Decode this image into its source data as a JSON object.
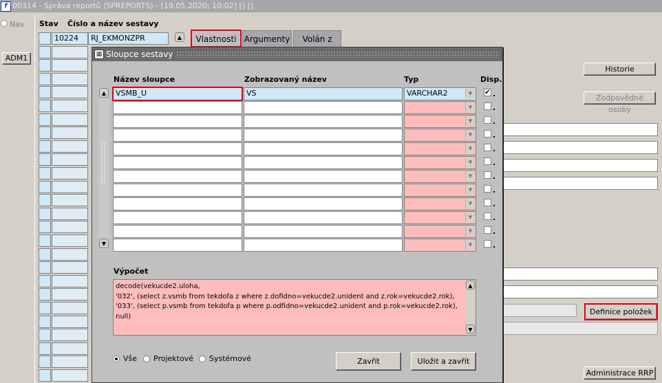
{
  "window": {
    "title": "00314 - Správa reportů (SPREPORTS) - [19.05.2020; 10:02]  []  []",
    "app_icon": "app-logo-icon"
  },
  "left_panel": {
    "nav_label": "Nav",
    "adm_button": "ADM1"
  },
  "main": {
    "col_stav": "Stav",
    "col_cislo": "Číslo a název sestavy",
    "report_number": "10224",
    "report_name": "RJ_EKMONZPR",
    "tabs": [
      {
        "label": "Vlastnosti"
      },
      {
        "label": "Argumenty"
      },
      {
        "label": "Volán z"
      }
    ],
    "buttons": {
      "historie": "Historie",
      "zodpovedne": "Zodpovědné osoby",
      "definice": "Definice položek",
      "administrace": "Administrace RRP"
    }
  },
  "dialog": {
    "title": "Sloupce sestavy",
    "headers": {
      "nazev": "Název sloupce",
      "zobrazovany": "Zobrazovaný název",
      "typ": "Typ",
      "disp": "Disp."
    },
    "rows": [
      {
        "nazev": "VSMB_U",
        "zobrazovany": "VS",
        "typ": "VARCHAR2",
        "disp": true
      },
      {
        "nazev": "",
        "zobrazovany": "",
        "typ": "",
        "disp": false
      },
      {
        "nazev": "",
        "zobrazovany": "",
        "typ": "",
        "disp": false
      },
      {
        "nazev": "",
        "zobrazovany": "",
        "typ": "",
        "disp": false
      },
      {
        "nazev": "",
        "zobrazovany": "",
        "typ": "",
        "disp": false
      },
      {
        "nazev": "",
        "zobrazovany": "",
        "typ": "",
        "disp": false
      },
      {
        "nazev": "",
        "zobrazovany": "",
        "typ": "",
        "disp": false
      },
      {
        "nazev": "",
        "zobrazovany": "",
        "typ": "",
        "disp": false
      },
      {
        "nazev": "",
        "zobrazovany": "",
        "typ": "",
        "disp": false
      },
      {
        "nazev": "",
        "zobrazovany": "",
        "typ": "",
        "disp": false
      },
      {
        "nazev": "",
        "zobrazovany": "",
        "typ": "",
        "disp": false
      },
      {
        "nazev": "",
        "zobrazovany": "",
        "typ": "",
        "disp": false
      }
    ],
    "vypocet_label": "Výpočet",
    "vypocet_lines": [
      "decode(vekucde2.uloha,",
      "'032', (select z.vsmb from tekdofa z where z.dofidno=vekucde2.unident and z.rok=vekucde2.rok),",
      "'033', (select p.vsmb from tekdofa p where p.odfidno=vekucde2.unident and p.rok=vekucde2.rok),",
      "null)"
    ],
    "radios": [
      {
        "label": "Vše",
        "checked": true
      },
      {
        "label": "Projektové",
        "checked": false
      },
      {
        "label": "Systémové",
        "checked": false
      }
    ],
    "close_button": "Zavřít",
    "save_close_button": "Uložit a zavřít"
  },
  "colors": {
    "accent_red": "#e0001b",
    "field_pink": "#ffbcbc",
    "field_blue": "#d0e8f8"
  }
}
